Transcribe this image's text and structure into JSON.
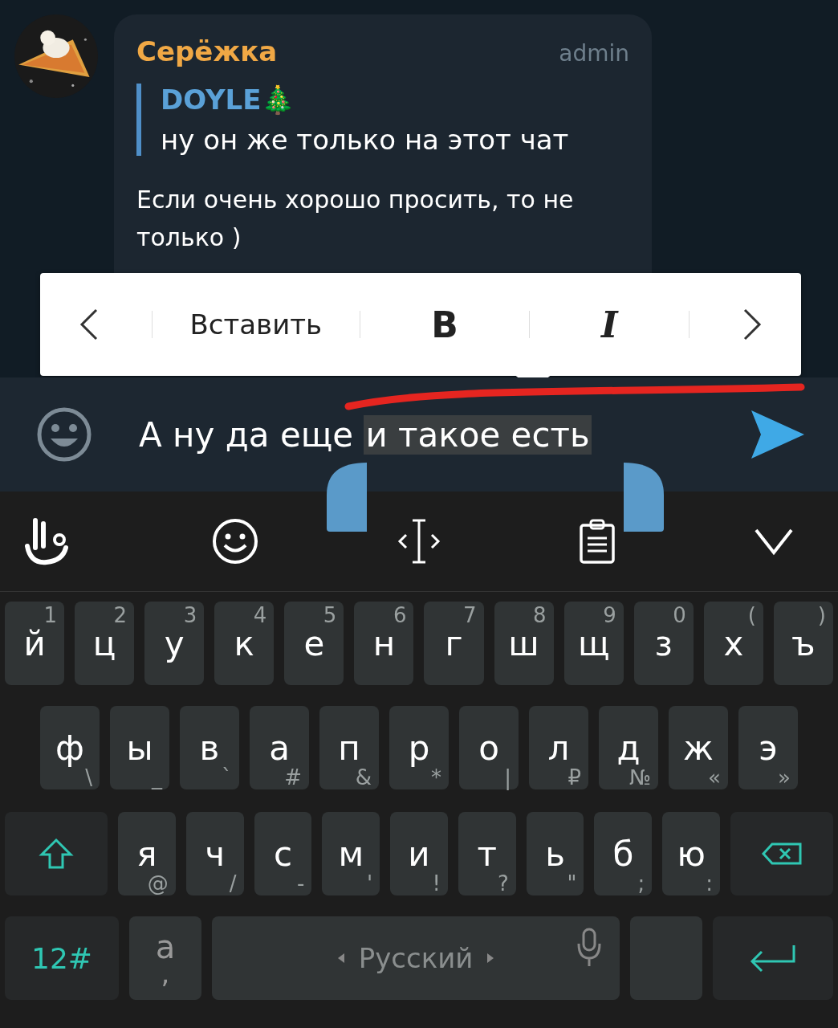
{
  "message": {
    "author": "Серёжка",
    "role": "admin",
    "reply": {
      "author": "DOYLE🎄",
      "text": "ну он же только на этот чат"
    },
    "text": "Если очень хорошо просить, то не только )"
  },
  "popup": {
    "items": [
      {
        "kind": "prev"
      },
      {
        "kind": "text",
        "label": "Вставить"
      },
      {
        "kind": "bold",
        "label": "B"
      },
      {
        "kind": "italic",
        "label": "I"
      },
      {
        "kind": "next"
      }
    ]
  },
  "input": {
    "text": "А ну да еще ",
    "selected_text": "и такое есть"
  },
  "keyboard": {
    "rows": [
      {
        "keys": [
          {
            "kind": "key",
            "label": "й",
            "hint": "1"
          },
          {
            "kind": "key",
            "label": "ц",
            "hint": "2"
          },
          {
            "kind": "key",
            "label": "у",
            "hint": "3"
          },
          {
            "kind": "key",
            "label": "к",
            "hint": "4"
          },
          {
            "kind": "key",
            "label": "е",
            "hint": "5"
          },
          {
            "kind": "key",
            "label": "н",
            "hint": "6"
          },
          {
            "kind": "key",
            "label": "г",
            "hint": "7"
          },
          {
            "kind": "key",
            "label": "ш",
            "hint": "8"
          },
          {
            "kind": "key",
            "label": "щ",
            "hint": "9"
          },
          {
            "kind": "key",
            "label": "з",
            "hint": "0"
          },
          {
            "kind": "key",
            "label": "х",
            "hint": "("
          },
          {
            "kind": "key",
            "label": "ъ",
            "hint": ")"
          }
        ]
      },
      {
        "keys": [
          {
            "kind": "key",
            "label": "ф",
            "hint": "\\"
          },
          {
            "kind": "key",
            "label": "ы",
            "hint": "_"
          },
          {
            "kind": "key",
            "label": "в",
            "hint": "`"
          },
          {
            "kind": "key",
            "label": "а",
            "hint": "#"
          },
          {
            "kind": "key",
            "label": "п",
            "hint": "&"
          },
          {
            "kind": "key",
            "label": "р",
            "hint": "*"
          },
          {
            "kind": "key",
            "label": "о",
            "hint": "|"
          },
          {
            "kind": "key",
            "label": "л",
            "hint": "₽"
          },
          {
            "kind": "key",
            "label": "д",
            "hint": "№"
          },
          {
            "kind": "key",
            "label": "ж",
            "hint": "«"
          },
          {
            "kind": "key",
            "label": "э",
            "hint": "»"
          }
        ]
      },
      {
        "keys": [
          {
            "kind": "shift"
          },
          {
            "kind": "key",
            "label": "я",
            "hint": "@"
          },
          {
            "kind": "key",
            "label": "ч",
            "hint": "/"
          },
          {
            "kind": "key",
            "label": "с",
            "hint": "-"
          },
          {
            "kind": "key",
            "label": "м",
            "hint": "'"
          },
          {
            "kind": "key",
            "label": "и",
            "hint": "!"
          },
          {
            "kind": "key",
            "label": "т",
            "hint": "?"
          },
          {
            "kind": "key",
            "label": "ь",
            "hint": "\""
          },
          {
            "kind": "key",
            "label": "б",
            "hint": ";"
          },
          {
            "kind": "key",
            "label": "ю",
            "hint": ":"
          },
          {
            "kind": "backspace"
          }
        ]
      }
    ],
    "bottom_bar": {
      "symbols_key": "12#",
      "punctuation_key": {
        "label": "a",
        "hint": ","
      },
      "space_key": "Русский"
    }
  }
}
